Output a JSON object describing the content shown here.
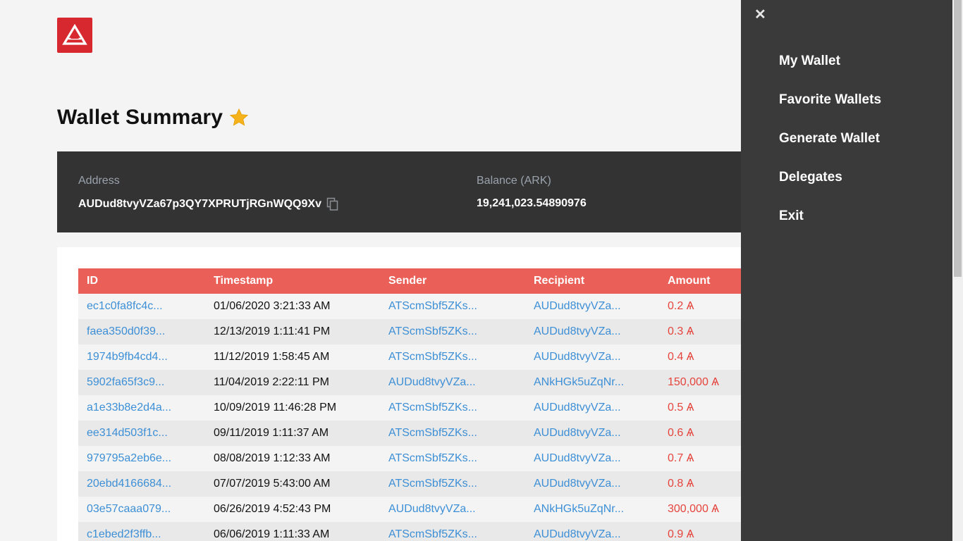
{
  "colors": {
    "brand": "#d7282f",
    "header_row": "#ea5f57",
    "link": "#3d8fd6",
    "amount": "#e5443d",
    "drawer_bg": "#3a3a3a",
    "summary_bg": "#333333"
  },
  "header": {
    "logo_icon": "ark-logo-icon"
  },
  "page": {
    "title": "Wallet Summary",
    "favorite_icon": "star-icon"
  },
  "summary": {
    "address_label": "Address",
    "address_value": "AUDud8tvyVZa67p3QY7XPRUTjRGnWQQ9Xv",
    "copy_icon": "copy-icon",
    "balance_label": "Balance (ARK)",
    "balance_value": "19,241,023.54890976"
  },
  "table": {
    "columns": [
      "ID",
      "Timestamp",
      "Sender",
      "Recipient",
      "Amount"
    ],
    "rows": [
      [
        "ec1c0fa8fc4c...",
        "01/06/2020 3:21:33 AM",
        "ATScmSbf5ZKs...",
        "AUDud8tvyVZa...",
        "0.2 Ѧ"
      ],
      [
        "faea350d0f39...",
        "12/13/2019 1:11:41 PM",
        "ATScmSbf5ZKs...",
        "AUDud8tvyVZa...",
        "0.3 Ѧ"
      ],
      [
        "1974b9fb4cd4...",
        "11/12/2019 1:58:45 AM",
        "ATScmSbf5ZKs...",
        "AUDud8tvyVZa...",
        "0.4 Ѧ"
      ],
      [
        "5902fa65f3c9...",
        "11/04/2019 2:22:11 PM",
        "AUDud8tvyVZa...",
        "ANkHGk5uZqNr...",
        "150,000 Ѧ"
      ],
      [
        "a1e33b8e2d4a...",
        "10/09/2019 11:46:28 PM",
        "ATScmSbf5ZKs...",
        "AUDud8tvyVZa...",
        "0.5 Ѧ"
      ],
      [
        "ee314d503f1c...",
        "09/11/2019 1:11:37 AM",
        "ATScmSbf5ZKs...",
        "AUDud8tvyVZa...",
        "0.6 Ѧ"
      ],
      [
        "979795a2eb6e...",
        "08/08/2019 1:12:33 AM",
        "ATScmSbf5ZKs...",
        "AUDud8tvyVZa...",
        "0.7 Ѧ"
      ],
      [
        "20ebd4166684...",
        "07/07/2019 5:43:00 AM",
        "ATScmSbf5ZKs...",
        "AUDud8tvyVZa...",
        "0.8 Ѧ"
      ],
      [
        "03e57caaa079...",
        "06/26/2019 4:52:43 PM",
        "AUDud8tvyVZa...",
        "ANkHGk5uZqNr...",
        "300,000 Ѧ"
      ],
      [
        "c1ebed2f3ffb...",
        "06/06/2019 1:11:33 AM",
        "ATScmSbf5ZKs...",
        "AUDud8tvyVZa...",
        "0.9 Ѧ"
      ]
    ]
  },
  "drawer": {
    "close_label": "✕",
    "items": [
      "My Wallet",
      "Favorite Wallets",
      "Generate Wallet",
      "Delegates",
      "Exit"
    ]
  }
}
